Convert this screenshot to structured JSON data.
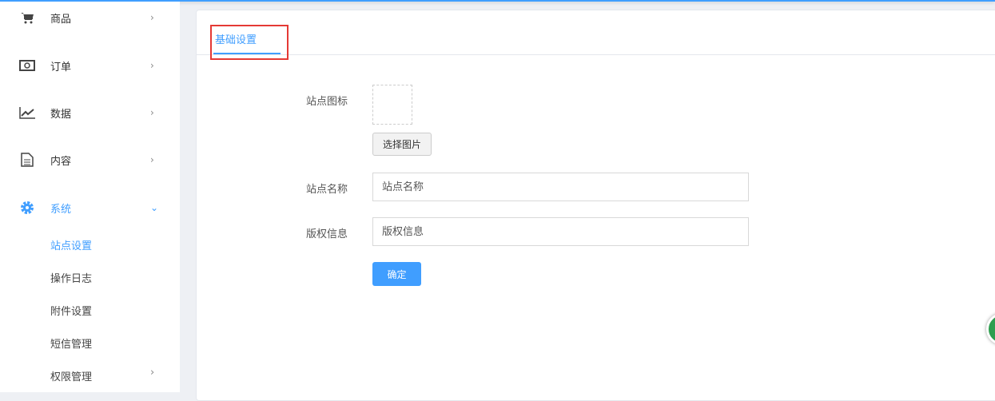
{
  "sidebar": {
    "items": [
      {
        "label": "商品",
        "icon": "cart-icon"
      },
      {
        "label": "订单",
        "icon": "money-icon"
      },
      {
        "label": "数据",
        "icon": "chart-line-icon"
      },
      {
        "label": "内容",
        "icon": "document-icon"
      },
      {
        "label": "系统",
        "icon": "gear-icon"
      }
    ],
    "sub_items": [
      "站点设置",
      "操作日志",
      "附件设置",
      "短信管理",
      "权限管理"
    ]
  },
  "main": {
    "tab": "基础设置",
    "fields": {
      "icon_label": "站点图标",
      "choose_image": "选择图片",
      "name_label": "站点名称",
      "name_placeholder": "站点名称",
      "copyright_label": "版权信息",
      "copyright_placeholder": "版权信息",
      "submit": "确定"
    }
  },
  "colors": {
    "accent": "#409eff",
    "highlight": "#e53935"
  }
}
